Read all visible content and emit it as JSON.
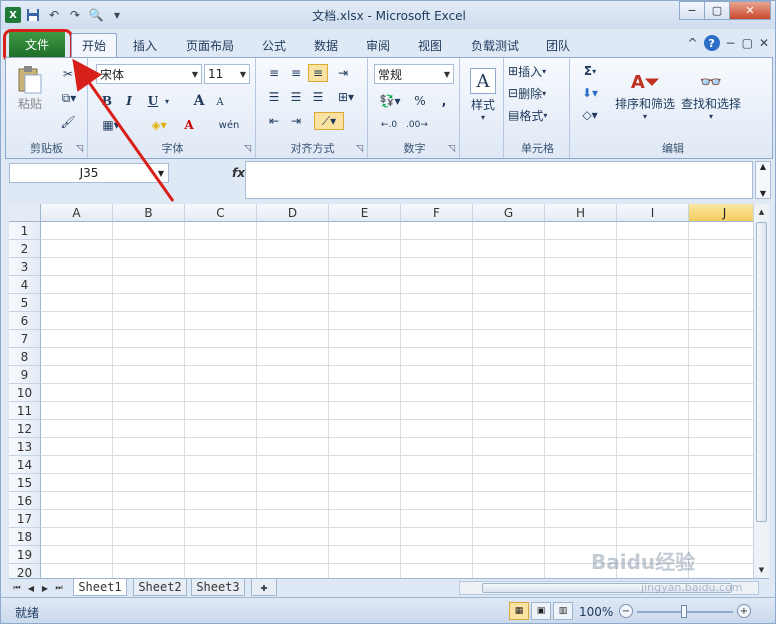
{
  "window": {
    "title": "文档.xlsx  -  Microsoft Excel",
    "app_icon_letter": "X",
    "controls": {
      "minimize": "−",
      "restore": "▢",
      "close": "✕"
    }
  },
  "qat": {
    "save": "💾",
    "undo": "↶",
    "redo": "↷",
    "print_preview": "🔍",
    "customize": "▾"
  },
  "tabs": {
    "file": "文件",
    "items": [
      "开始",
      "插入",
      "页面布局",
      "公式",
      "数据",
      "审阅",
      "视图",
      "负载测试",
      "团队"
    ],
    "active_index": 0,
    "right_controls": {
      "help": "?",
      "minimize": "−",
      "restore": "▢",
      "close": "✕",
      "ribbon_toggle": "^"
    }
  },
  "ribbon": {
    "clipboard": {
      "label": "剪贴板",
      "paste": "粘贴"
    },
    "font": {
      "label": "字体",
      "font_name": "宋体",
      "font_size": "11",
      "bold": "B",
      "italic": "I",
      "underline": "U",
      "grow": "A",
      "shrink": "A",
      "font_color": "A",
      "phonetic": "wén"
    },
    "alignment": {
      "label": "对齐方式"
    },
    "number": {
      "label": "数字",
      "format": "常规",
      "percent": "%",
      "comma": ","
    },
    "styles": {
      "label": "样式"
    },
    "cells": {
      "label": "单元格",
      "insert": "插入",
      "delete": "删除",
      "format": "格式"
    },
    "editing": {
      "label": "编辑",
      "sum": "Σ",
      "sort_filter": "排序和筛选",
      "find_select": "查找和选择"
    }
  },
  "formula_bar": {
    "name_box": "J35",
    "fx": "fx",
    "content": ""
  },
  "grid": {
    "columns": [
      "A",
      "B",
      "C",
      "D",
      "E",
      "F",
      "G",
      "H",
      "I",
      "J"
    ],
    "rows": [
      "1",
      "2",
      "3",
      "4",
      "5",
      "6",
      "7",
      "8",
      "9",
      "10",
      "11",
      "12",
      "13",
      "14",
      "15",
      "16",
      "17",
      "18",
      "19",
      "20"
    ],
    "selected_column": "J"
  },
  "sheets": {
    "tabs": [
      "Sheet1",
      "Sheet2",
      "Sheet3"
    ],
    "active_index": 0,
    "new_sheet": "✚"
  },
  "status": {
    "ready": "就绪",
    "zoom": "100%",
    "zoom_out": "−",
    "zoom_in": "+"
  },
  "watermark": {
    "text": "Baidu经验",
    "sub": "jingyan.baidu.com"
  },
  "colors": {
    "file_tab": "#2e8b3a",
    "highlight": "#d8201b",
    "selected_header": "#f4cd5d"
  }
}
